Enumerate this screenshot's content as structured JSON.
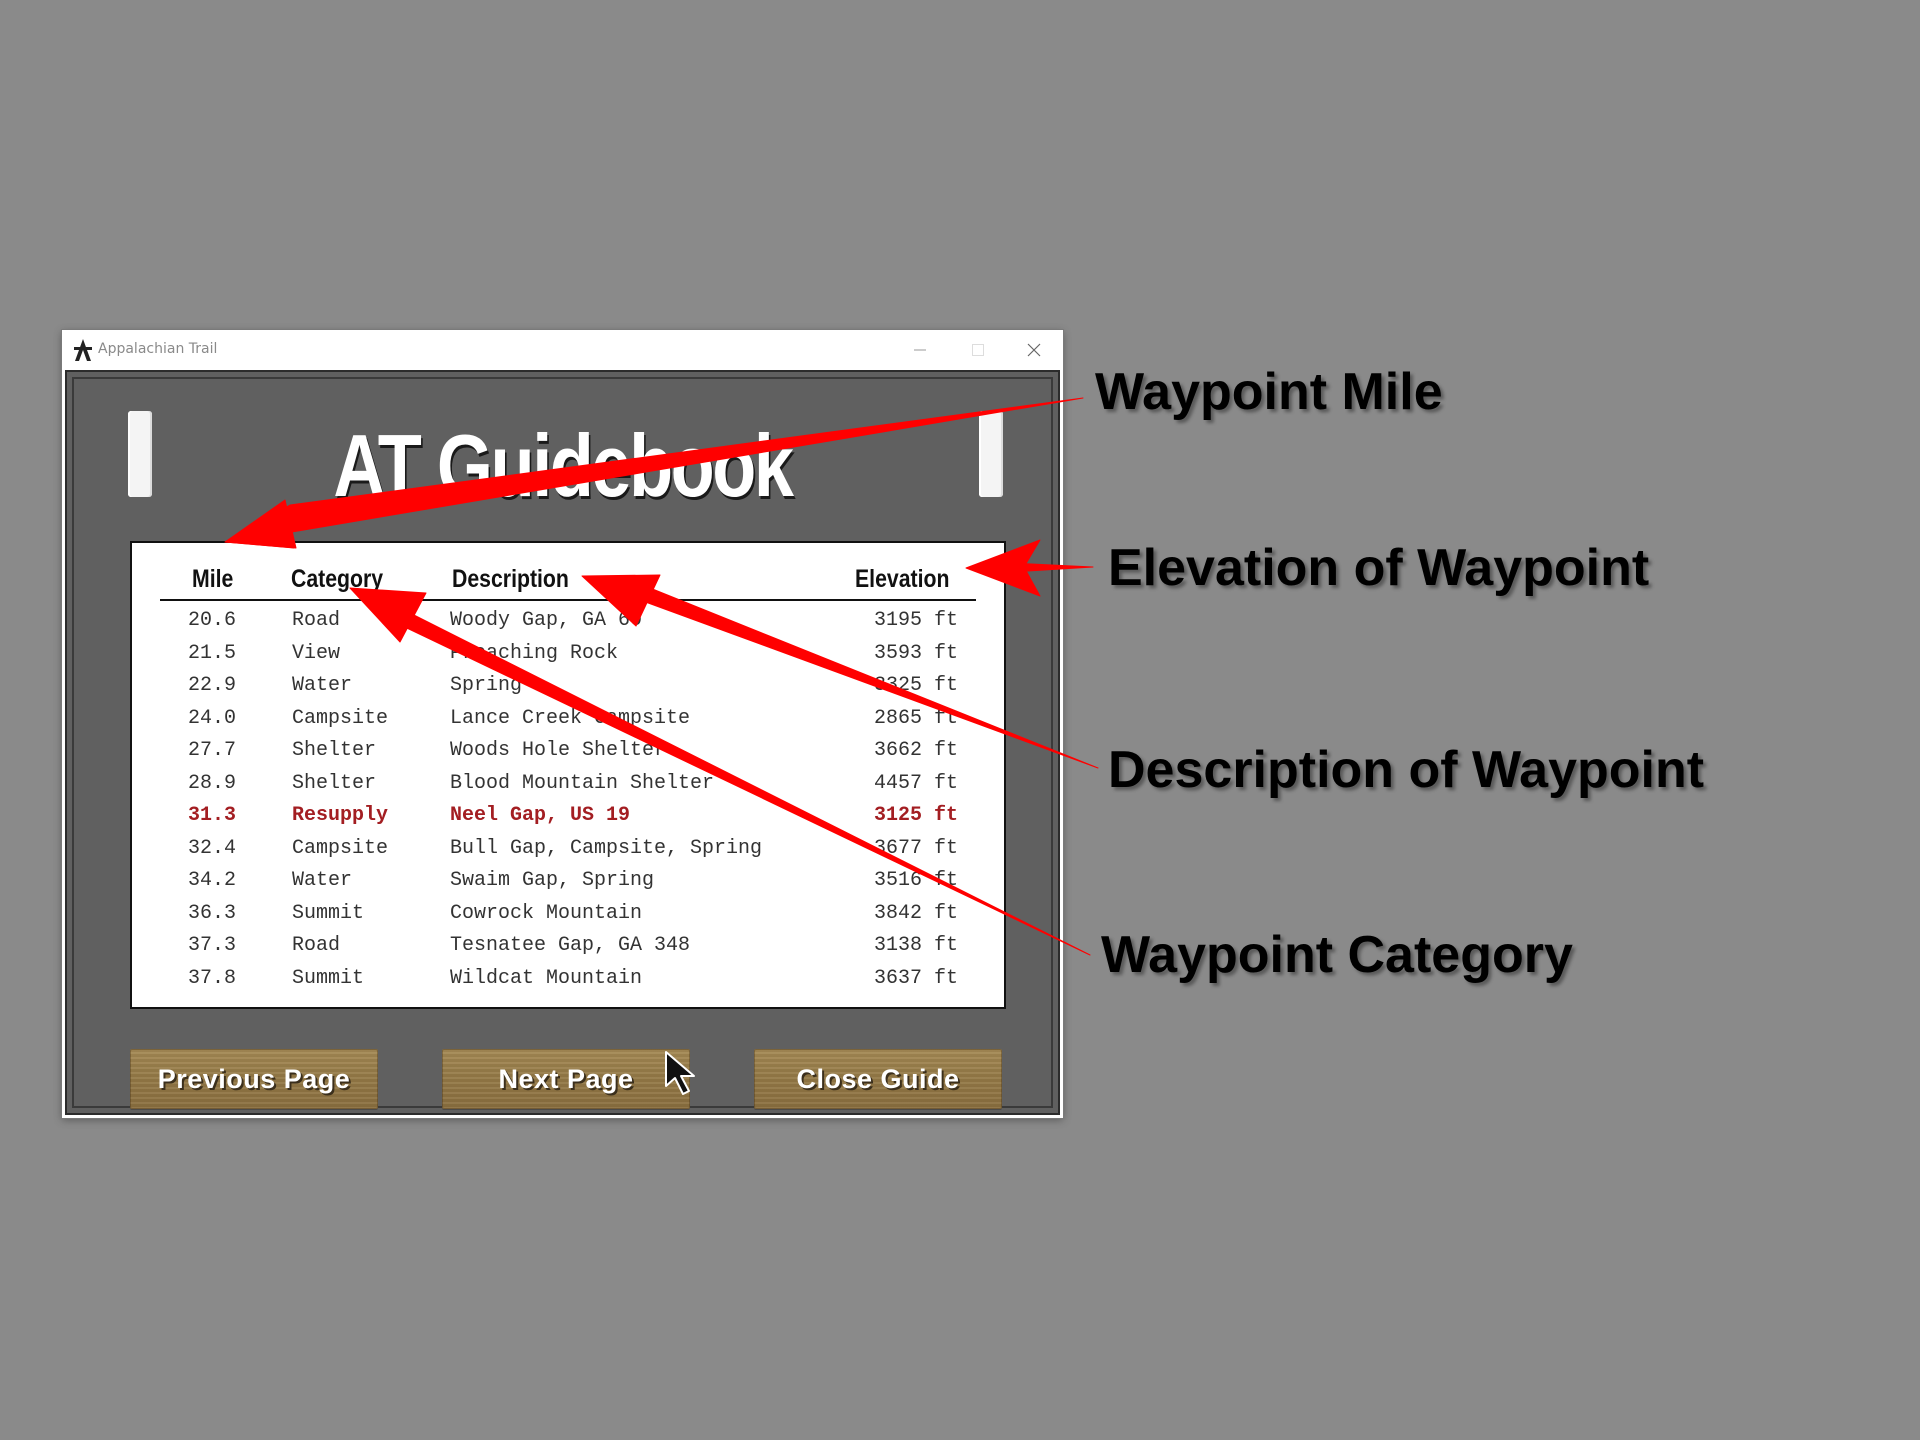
{
  "window": {
    "title": "Appalachian Trail"
  },
  "header": {
    "title": "AT Guidebook"
  },
  "table": {
    "columns": {
      "mile": "Mile",
      "category": "Category",
      "description": "Description",
      "elevation": "Elevation"
    },
    "rows": [
      {
        "mile": "20.6",
        "category": "Road",
        "description": "Woody Gap, GA 60",
        "elevation": "3195 ft",
        "highlight": false
      },
      {
        "mile": "21.5",
        "category": "View",
        "description": "Preaching Rock",
        "elevation": "3593 ft",
        "highlight": false
      },
      {
        "mile": "22.9",
        "category": "Water",
        "description": "Spring",
        "elevation": "3325 ft",
        "highlight": false
      },
      {
        "mile": "24.0",
        "category": "Campsite",
        "description": "Lance Creek Campsite",
        "elevation": "2865 ft",
        "highlight": false
      },
      {
        "mile": "27.7",
        "category": "Shelter",
        "description": "Woods Hole Shelter",
        "elevation": "3662 ft",
        "highlight": false
      },
      {
        "mile": "28.9",
        "category": "Shelter",
        "description": "Blood Mountain Shelter",
        "elevation": "4457 ft",
        "highlight": false
      },
      {
        "mile": "31.3",
        "category": "Resupply",
        "description": "Neel Gap, US 19",
        "elevation": "3125 ft",
        "highlight": true
      },
      {
        "mile": "32.4",
        "category": "Campsite",
        "description": "Bull Gap, Campsite, Spring",
        "elevation": "3677 ft",
        "highlight": false
      },
      {
        "mile": "34.2",
        "category": "Water",
        "description": "Swaim Gap, Spring",
        "elevation": "3516 ft",
        "highlight": false
      },
      {
        "mile": "36.3",
        "category": "Summit",
        "description": "Cowrock Mountain",
        "elevation": "3842 ft",
        "highlight": false
      },
      {
        "mile": "37.3",
        "category": "Road",
        "description": "Tesnatee Gap, GA 348",
        "elevation": "3138 ft",
        "highlight": false
      },
      {
        "mile": "37.8",
        "category": "Summit",
        "description": "Wildcat Mountain",
        "elevation": "3637 ft",
        "highlight": false
      }
    ]
  },
  "buttons": {
    "previous": "Previous Page",
    "next": "Next Page",
    "close": "Close Guide"
  },
  "annotations": {
    "mile": "Waypoint Mile",
    "elevation": "Elevation of Waypoint",
    "description": "Description of Waypoint",
    "category": "Waypoint Category"
  },
  "colors": {
    "background": "#8a8a8a",
    "client": "#606060",
    "highlight_row": "#a31e22",
    "arrow": "#ff0000",
    "wood": "#957a47"
  },
  "icons": {
    "app": "trail-logo-icon",
    "minimize": "minimize-icon",
    "maximize": "maximize-icon",
    "close": "close-icon",
    "cursor": "mouse-cursor-icon"
  }
}
